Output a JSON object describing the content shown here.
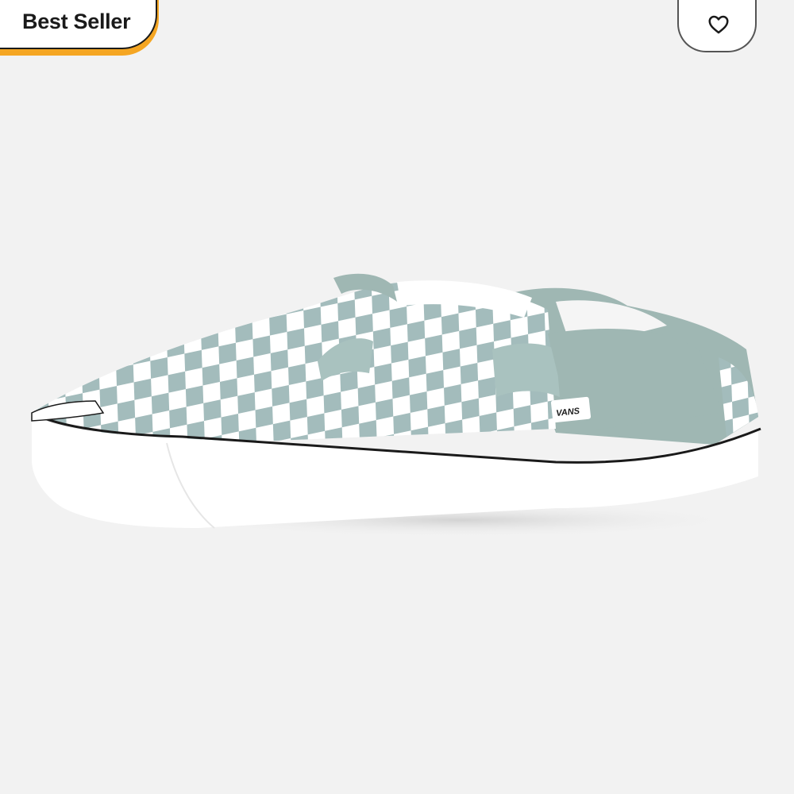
{
  "badge": {
    "label": "Best Seller",
    "accent_color": "#f5a623"
  },
  "favorite": {
    "icon": "heart-icon"
  },
  "product": {
    "logo_text": "VANS",
    "colors": {
      "check": "#a3bcbc",
      "canvas": "#9fb7b3",
      "white": "#ffffff",
      "foxing_stripe": "#1a1a1a"
    }
  }
}
